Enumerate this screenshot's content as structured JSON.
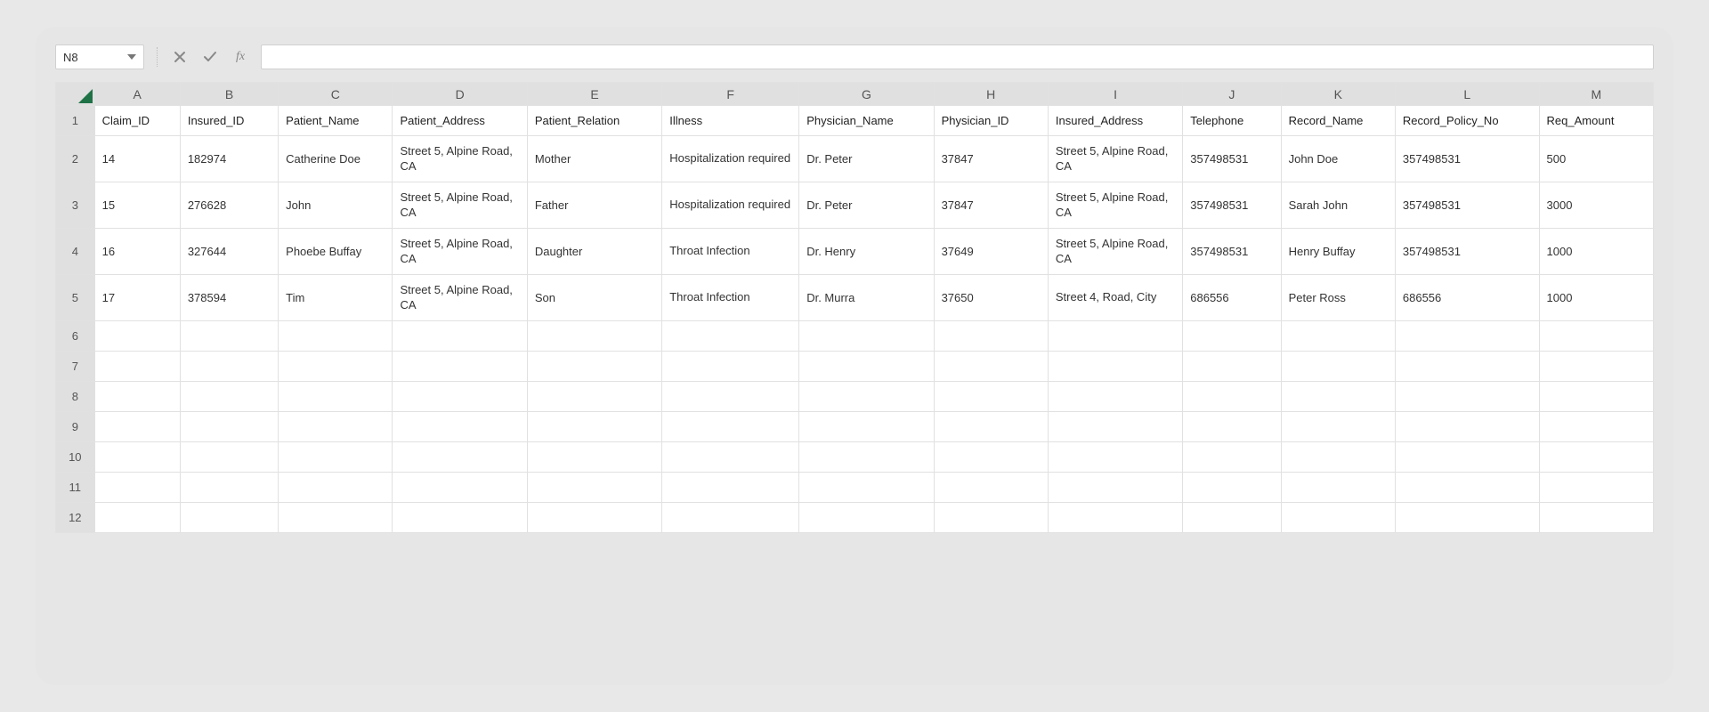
{
  "formula_bar": {
    "name_box": "N8",
    "formula_value": ""
  },
  "columns": [
    "A",
    "B",
    "C",
    "D",
    "E",
    "F",
    "G",
    "H",
    "I",
    "J",
    "K",
    "L",
    "M"
  ],
  "row_numbers": [
    1,
    2,
    3,
    4,
    5,
    6,
    7,
    8,
    9,
    10,
    11,
    12
  ],
  "headers": [
    "Claim_ID",
    "Insured_ID",
    "Patient_Name",
    "Patient_Address",
    "Patient_Relation",
    "Illness",
    "Physician_Name",
    "Physician_ID",
    "Insured_Address",
    "Telephone",
    "Record_Name",
    "Record_Policy_No",
    "Req_Amount"
  ],
  "rows": [
    {
      "Claim_ID": "14",
      "Insured_ID": "182974",
      "Patient_Name": "Catherine Doe",
      "Patient_Address": "Street 5, Alpine Road, CA",
      "Patient_Relation": "Mother",
      "Illness": "Hospitalization required",
      "Physician_Name": "Dr. Peter",
      "Physician_ID": "37847",
      "Insured_Address": "Street 5, Alpine Road, CA",
      "Telephone": "357498531",
      "Record_Name": "John Doe",
      "Record_Policy_No": "357498531",
      "Req_Amount": "500"
    },
    {
      "Claim_ID": "15",
      "Insured_ID": "276628",
      "Patient_Name": "John",
      "Patient_Address": "Street 5, Alpine Road, CA",
      "Patient_Relation": "Father",
      "Illness": "Hospitalization required",
      "Physician_Name": "Dr. Peter",
      "Physician_ID": "37847",
      "Insured_Address": "Street 5, Alpine Road, CA",
      "Telephone": "357498531",
      "Record_Name": "Sarah John",
      "Record_Policy_No": "357498531",
      "Req_Amount": "3000"
    },
    {
      "Claim_ID": "16",
      "Insured_ID": "327644",
      "Patient_Name": "Phoebe Buffay",
      "Patient_Address": "Street 5, Alpine Road, CA",
      "Patient_Relation": "Daughter",
      "Illness": "Throat Infection",
      "Physician_Name": "Dr. Henry",
      "Physician_ID": "37649",
      "Insured_Address": "Street 5, Alpine Road, CA",
      "Telephone": "357498531",
      "Record_Name": "Henry Buffay",
      "Record_Policy_No": "357498531",
      "Req_Amount": "1000"
    },
    {
      "Claim_ID": "17",
      "Insured_ID": "378594",
      "Patient_Name": "Tim",
      "Patient_Address": "Street 5, Alpine Road, CA",
      "Patient_Relation": "Son",
      "Illness": "Throat Infection",
      "Physician_Name": "Dr. Murra",
      "Physician_ID": "37650",
      "Insured_Address": "Street 4, Road, City",
      "Telephone": "686556",
      "Record_Name": "Peter Ross",
      "Record_Policy_No": "686556",
      "Req_Amount": "1000"
    }
  ],
  "empty_row_count": 7,
  "wrap_cols": [
    "Patient_Address",
    "Illness",
    "Insured_Address"
  ]
}
